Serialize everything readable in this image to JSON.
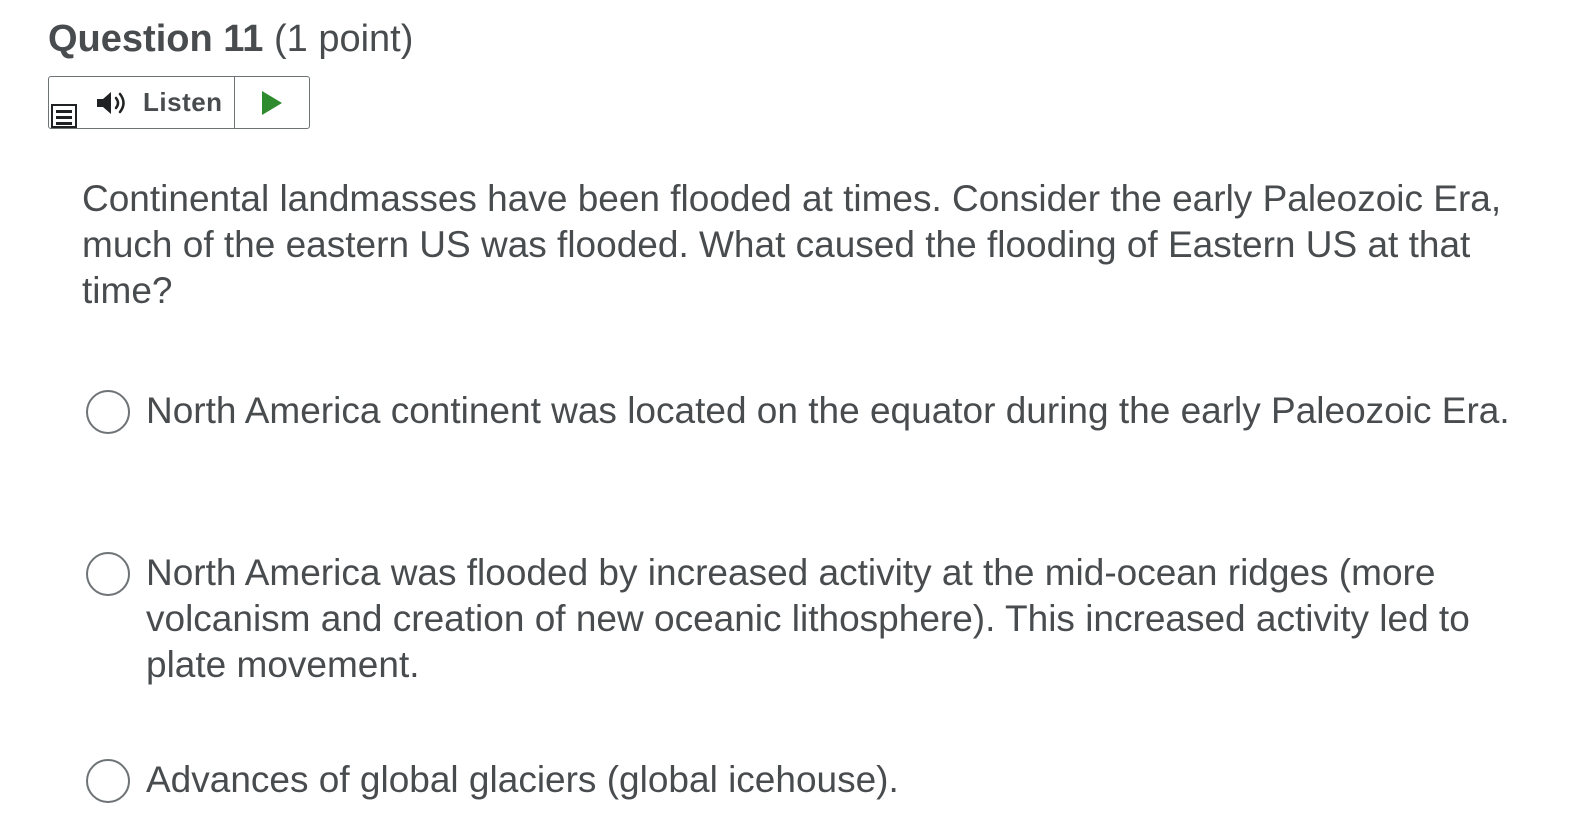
{
  "question": {
    "title": "Question 11",
    "points": "(1 point)",
    "text": "Continental landmasses have been flooded at times. Consider the early Paleozoic Era, much of the eastern US was flooded. What caused the flooding of Eastern US at that time?"
  },
  "listen": {
    "label": "Listen",
    "menu_icon": "menu-icon",
    "speaker_icon": "speaker-icon",
    "play_icon": "play-icon",
    "play_color": "#2e8b2e"
  },
  "options": [
    {
      "label": "North America continent was located on the equator during the early Paleozoic Era.",
      "selected": false
    },
    {
      "label": "North America was flooded by increased activity at the mid-ocean ridges (more volcanism and creation of new oceanic lithosphere). This increased activity led to plate movement.",
      "selected": false
    },
    {
      "label": "Advances of global glaciers (global icehouse).",
      "selected": false
    }
  ]
}
